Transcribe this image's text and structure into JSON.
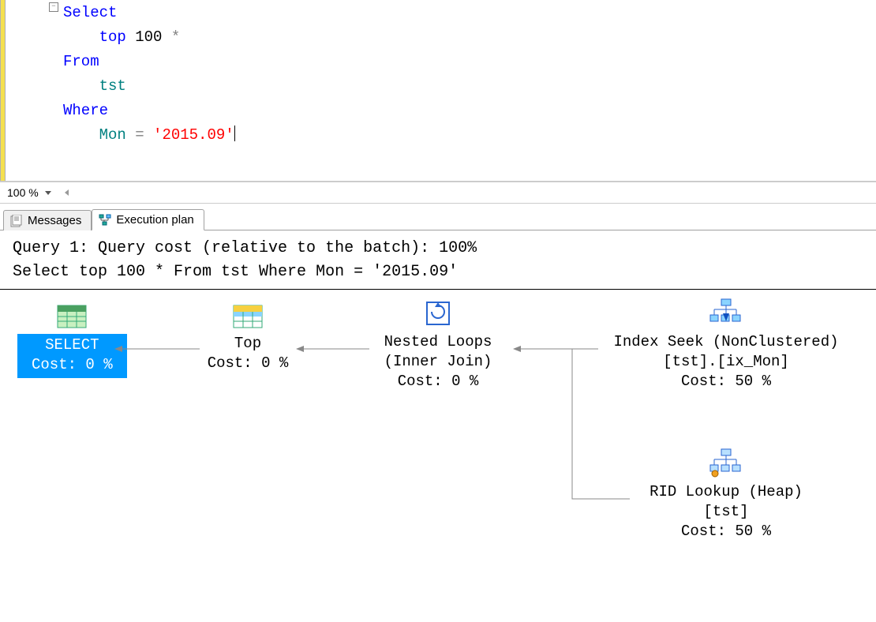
{
  "editor": {
    "line1_select": "Select",
    "line2_top": "top",
    "line2_num": " 100 ",
    "line2_star": "*",
    "line3_from": "From",
    "line4_tst": "tst",
    "line5_where": "Where",
    "line6_mon": "Mon",
    "line6_eq": " = ",
    "line6_str": "'2015.09'"
  },
  "zoom": {
    "value": "100 %"
  },
  "tabs": {
    "messages": "Messages",
    "execution": "Execution plan"
  },
  "query_header": {
    "line1": "Query 1: Query cost (relative to the batch): 100%",
    "line2": "Select top 100 * From tst Where Mon = '2015.09'"
  },
  "plan": {
    "select": {
      "label": "SELECT",
      "cost": "Cost: 0 %"
    },
    "top": {
      "label": "Top",
      "cost": "Cost: 0 %"
    },
    "nested": {
      "label": "Nested Loops",
      "sub": "(Inner Join)",
      "cost": "Cost: 0 %"
    },
    "seek": {
      "label": "Index Seek (NonClustered)",
      "sub": "[tst].[ix_Mon]",
      "cost": "Cost: 50 %"
    },
    "rid": {
      "label": "RID Lookup (Heap)",
      "sub": "[tst]",
      "cost": "Cost: 50 %"
    }
  }
}
